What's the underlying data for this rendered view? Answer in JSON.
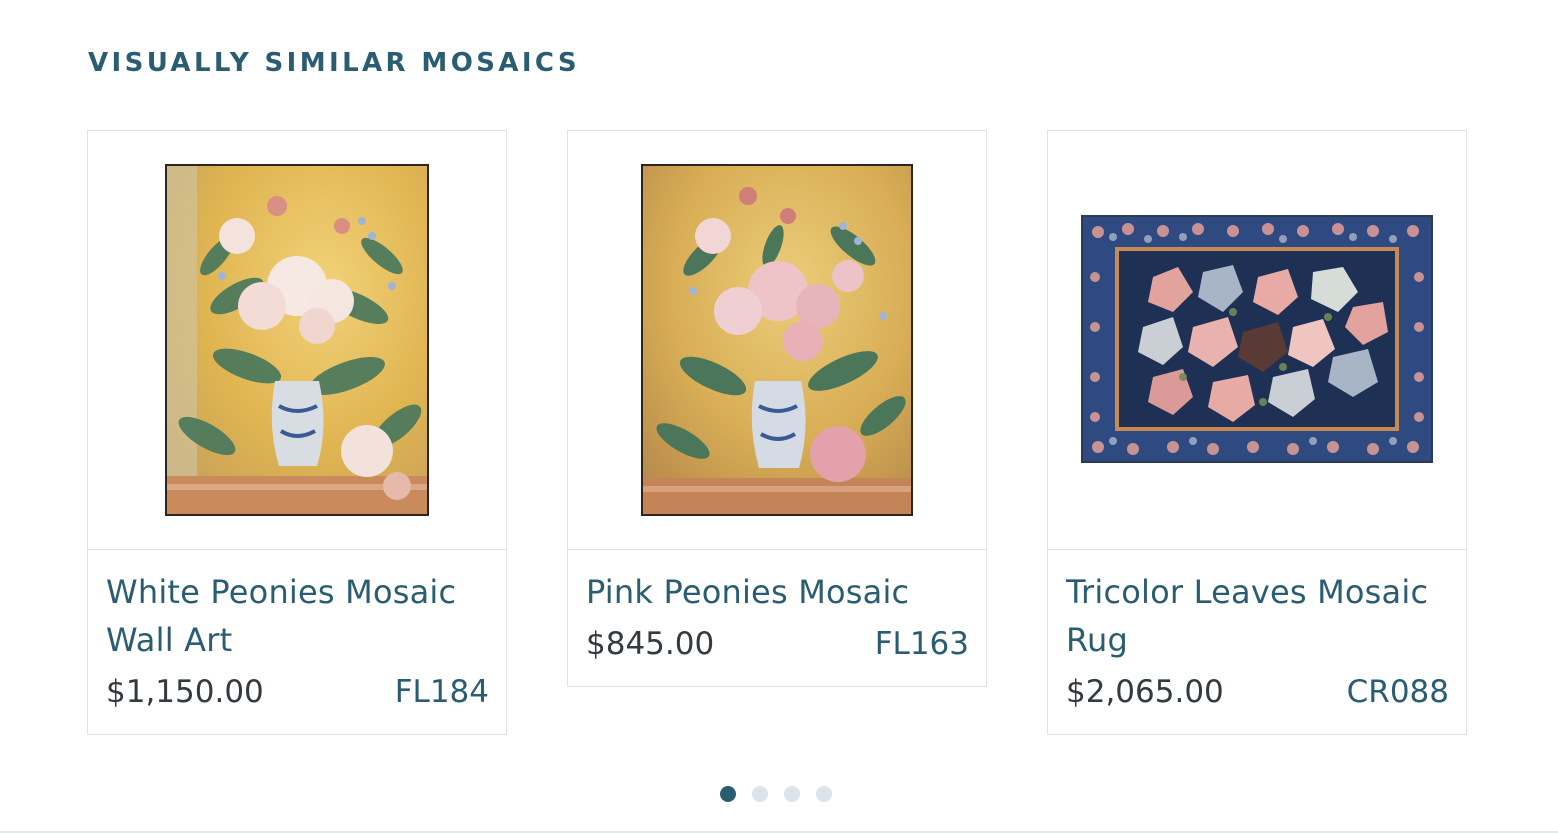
{
  "section": {
    "title": "VISUALLY SIMILAR MOSAICS"
  },
  "products": [
    {
      "name": "White Peonies Mosaic Wall Art",
      "price": "$1,150.00",
      "sku": "FL184"
    },
    {
      "name": "Pink Peonies Mosaic",
      "price": "$845.00",
      "sku": "FL163"
    },
    {
      "name": "Tricolor Leaves Mosaic Rug",
      "price": "$2,065.00",
      "sku": "CR088"
    }
  ],
  "carousel": {
    "page_count": 4,
    "active_page": 1
  },
  "colors": {
    "title": "#2a5d72",
    "product_name": "#2a5d72",
    "price": "#333a40",
    "sku": "#2a5d72",
    "dot_active": "#2a5d72",
    "dot_inactive": "#dde3ea",
    "border": "#dde3e6"
  }
}
